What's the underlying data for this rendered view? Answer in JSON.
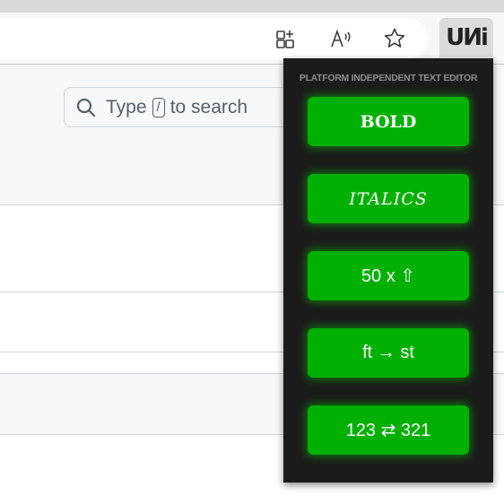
{
  "browser": {
    "toolbar_icons": [
      "add-to-apps-icon",
      "read-aloud-icon",
      "favorite-star-icon"
    ],
    "extension_logo": "UИi"
  },
  "page": {
    "search": {
      "prefix": "Type",
      "key": "/",
      "suffix": "to search"
    }
  },
  "popup": {
    "title": "PLATFORM INDEPENDENT TEXT EDITOR",
    "buttons": [
      {
        "label": "BOLD",
        "style": "bold"
      },
      {
        "label": "ITALICS",
        "style": "italic"
      },
      {
        "label": "50 x ⇧",
        "style": "sans"
      },
      {
        "label": "ft → st",
        "style": "sans"
      },
      {
        "label": "123 ⇄ 321",
        "style": "sans"
      }
    ],
    "colors": {
      "background": "#1b1b1b",
      "button": "#00b000",
      "glow": "#00e600",
      "title": "#8c8c8c"
    }
  }
}
